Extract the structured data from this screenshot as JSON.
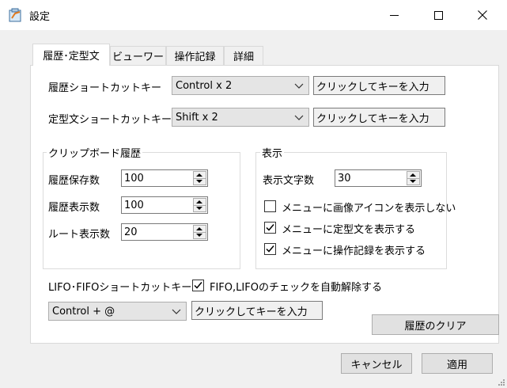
{
  "window": {
    "title": "設定"
  },
  "tabs": [
    {
      "label": "履歴･定型文",
      "active": true
    },
    {
      "label": "ビューワー",
      "active": false
    },
    {
      "label": "操作記録",
      "active": false
    },
    {
      "label": "詳細",
      "active": false
    }
  ],
  "history_shortcut": {
    "label": "履歴ショートカットキー",
    "value": "Control x 2",
    "keybox": "クリックしてキーを入力"
  },
  "template_shortcut": {
    "label": "定型文ショートカットキー",
    "value": "Shift x 2",
    "keybox": "クリックしてキーを入力"
  },
  "clipboard_group": {
    "title": "クリップボード履歴",
    "fields": [
      {
        "label": "履歴保存数",
        "value": "100"
      },
      {
        "label": "履歴表示数",
        "value": "100"
      },
      {
        "label": "ルート表示数",
        "value": "20"
      }
    ]
  },
  "display_group": {
    "title": "表示",
    "char_count": {
      "label": "表示文字数",
      "value": "30"
    },
    "checks": [
      {
        "label": "メニューに画像アイコンを表示しない",
        "checked": false
      },
      {
        "label": "メニューに定型文を表示する",
        "checked": true
      },
      {
        "label": "メニューに操作記録を表示する",
        "checked": true
      }
    ]
  },
  "lifo": {
    "label": "LIFO･FIFOショートカットキー",
    "auto_release": {
      "label": "FIFO,LIFOのチェックを自動解除する",
      "checked": true
    },
    "value": "Control + @",
    "keybox": "クリックしてキーを入力"
  },
  "buttons": {
    "clear_history": "履歴のクリア",
    "cancel": "キャンセル",
    "apply": "適用"
  }
}
